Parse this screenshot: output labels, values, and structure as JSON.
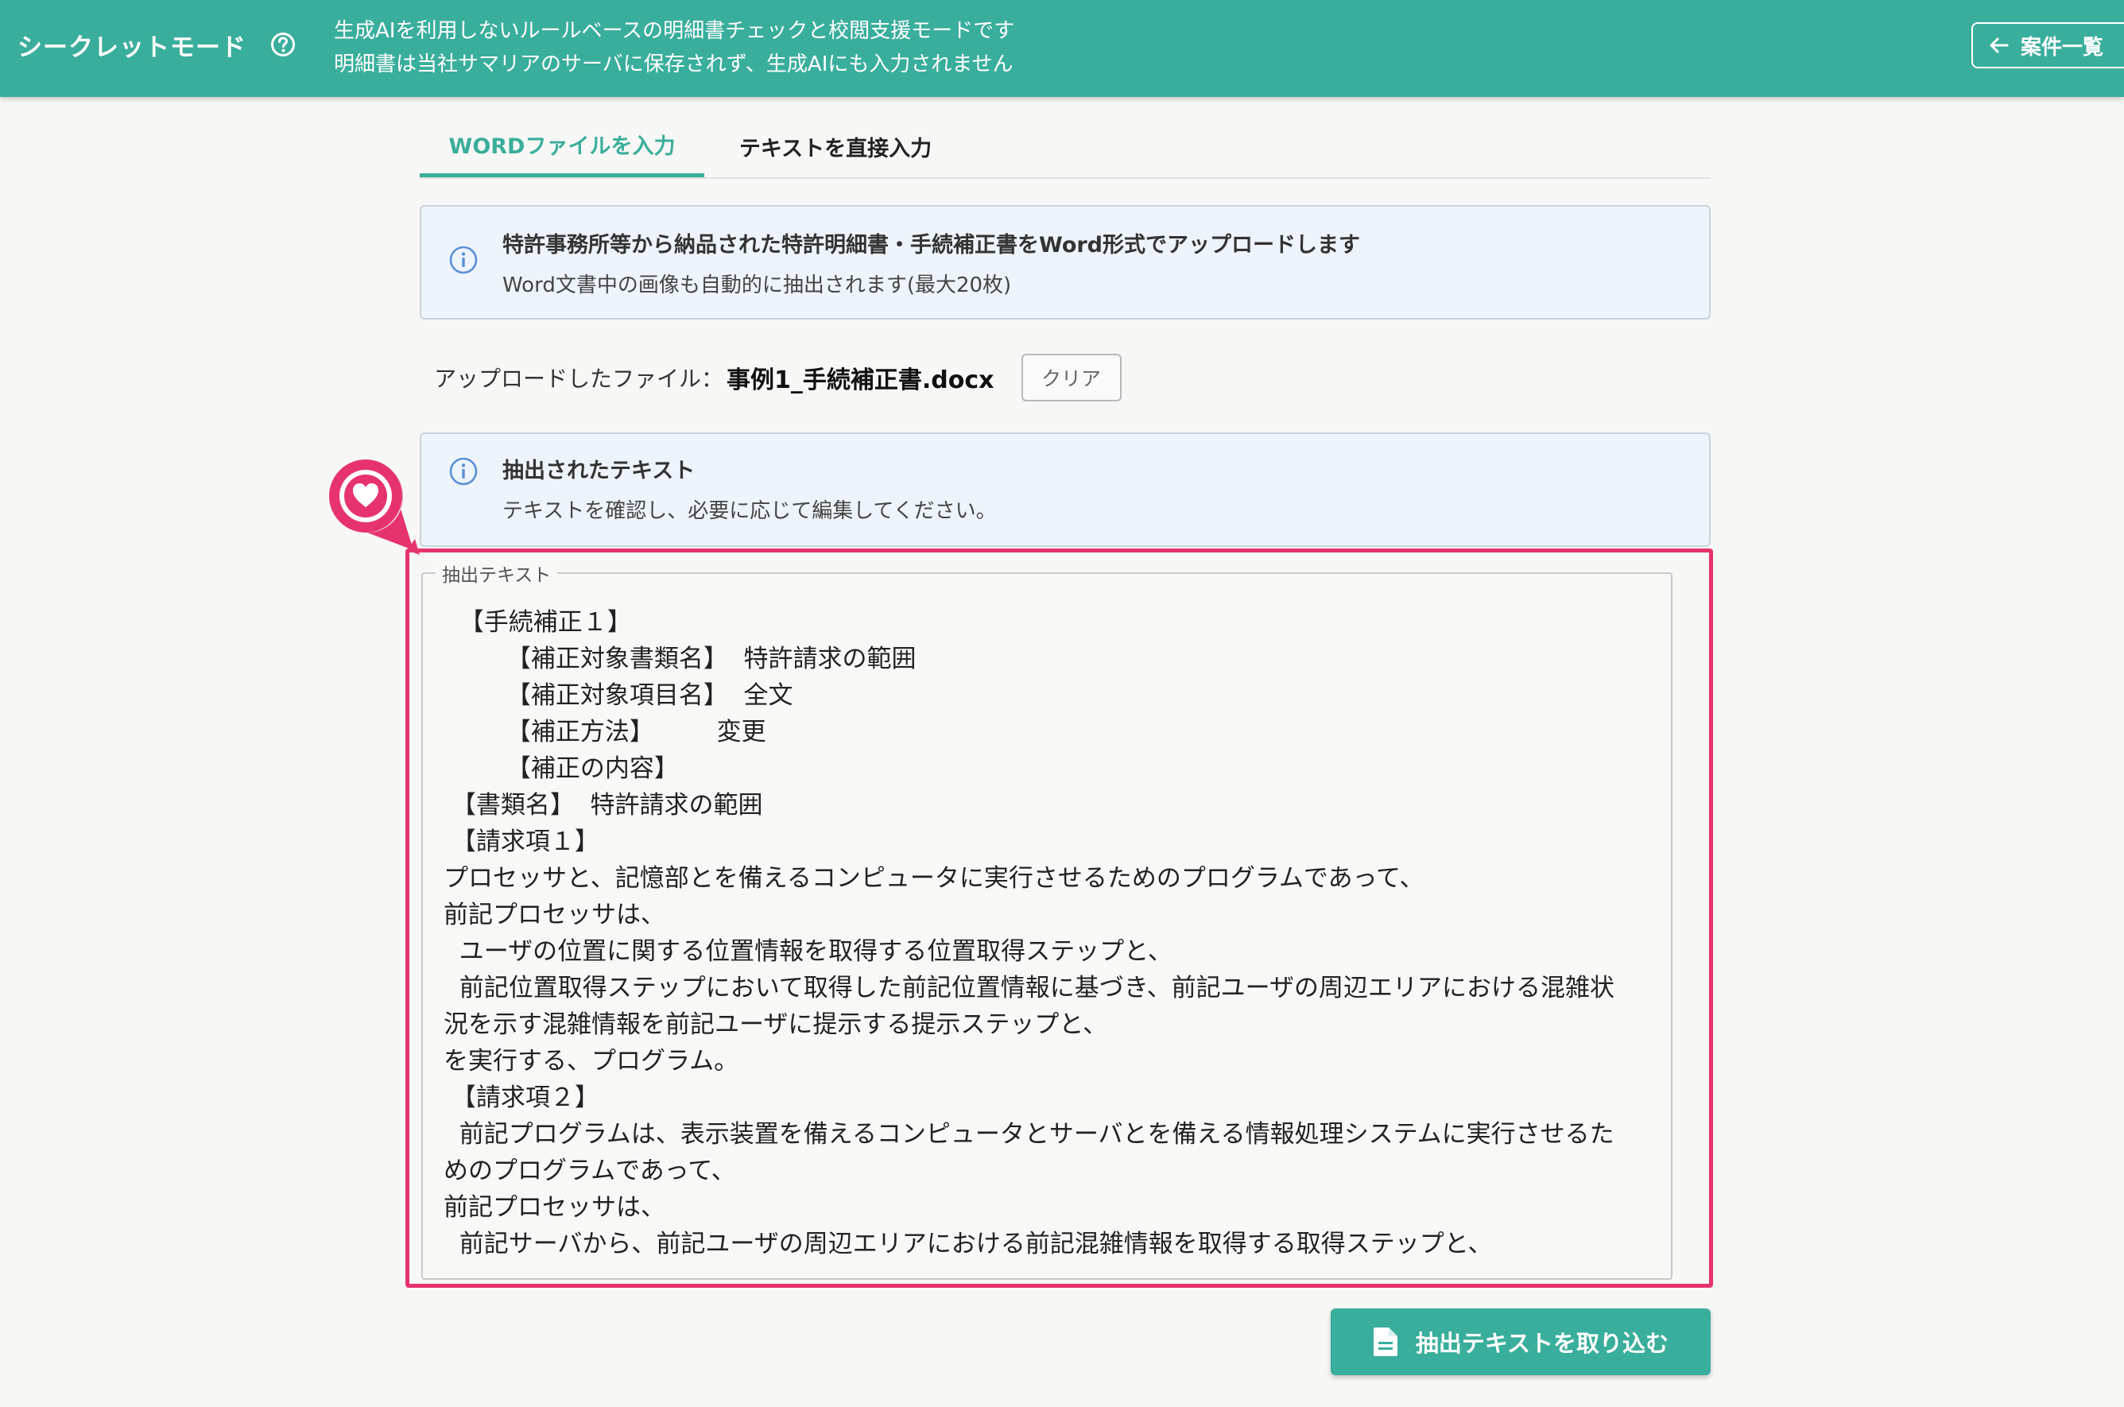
{
  "header": {
    "title": "シークレットモード",
    "description_line1": "生成AIを利用しないルールベースの明細書チェックと校閲支援モードです",
    "description_line2": "明細書は当社サマリアのサーバに保存されず、生成AIにも入力されません",
    "back_button_label": "案件一覧"
  },
  "tabs": [
    {
      "label": "WORDファイルを入力",
      "active": true
    },
    {
      "label": "テキストを直接入力",
      "active": false
    }
  ],
  "upload_info": {
    "title": "特許事務所等から納品された特許明細書・手続補正書をWord形式でアップロードします",
    "subtitle": "Word文書中の画像も自動的に抽出されます(最大20枚)"
  },
  "upload": {
    "label": "アップロードしたファイル：",
    "filename": "事例1_手続補正書.docx",
    "clear_label": "クリア"
  },
  "extracted_info": {
    "title": "抽出されたテキスト",
    "subtitle": "テキストを確認し、必要に応じて編集してください。"
  },
  "extracted_text": {
    "legend": "抽出テキスト",
    "lines": [
      "  【手続補正１】",
      "        【補正対象書類名】  特許請求の範囲",
      "        【補正対象項目名】  全文",
      "        【補正方法】        変更",
      "        【補正の内容】",
      " 【書類名】  特許請求の範囲",
      " 【請求項１】",
      "プロセッサと、記憶部とを備えるコンピュータに実行させるためのプログラムであって、",
      "前記プロセッサは、",
      "  ユーザの位置に関する位置情報を取得する位置取得ステップと、",
      "  前記位置取得ステップにおいて取得した前記位置情報に基づき、前記ユーザの周辺エリアにおける混雑状",
      "況を示す混雑情報を前記ユーザに提示する提示ステップと、",
      "を実行する、プログラム。",
      " 【請求項２】",
      "  前記プログラムは、表示装置を備えるコンピュータとサーバとを備える情報処理システムに実行させるた",
      "めのプログラムであって、",
      "前記プロセッサは、",
      "  前記サーバから、前記ユーザの周辺エリアにおける前記混雑情報を取得する取得ステップと、"
    ]
  },
  "import_button_label": "抽出テキストを取り込む",
  "colors": {
    "brand": "#3aae9c",
    "highlight": "#e6336e",
    "info_bg": "#eef4fc"
  }
}
